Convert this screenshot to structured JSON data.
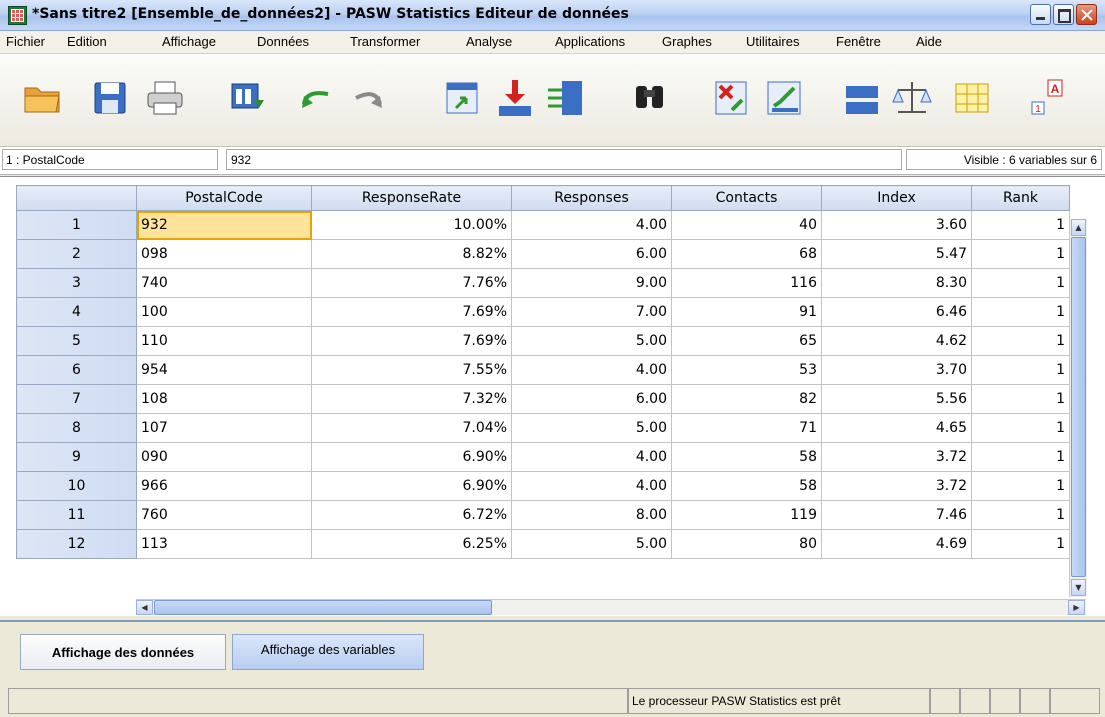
{
  "window": {
    "title": "*Sans titre2 [Ensemble_de_données2] - PASW Statistics Editeur de données"
  },
  "menu": [
    "Fichier",
    "Edition",
    "Affichage",
    "Données",
    "Transformer",
    "Analyse",
    "Applications",
    "Graphes",
    "Utilitaires",
    "Fenêtre",
    "Aide"
  ],
  "toolbar": {
    "icons": [
      "open-folder-icon",
      "save-icon",
      "print-icon",
      "dialog-recall-icon",
      "undo-icon",
      "redo-icon",
      "goto-case-icon",
      "goto-variable-icon",
      "variables-icon",
      "find-icon",
      "insert-cases-icon",
      "insert-variable-icon",
      "split-file-icon",
      "weight-cases-icon",
      "select-cases-icon",
      "value-labels-icon"
    ]
  },
  "editor": {
    "cell_ref": "1 : PostalCode",
    "cell_value": "932",
    "visible": "Visible : 6 variables sur 6"
  },
  "grid": {
    "columns": [
      "PostalCode",
      "ResponseRate",
      "Responses",
      "Contacts",
      "Index",
      "Rank"
    ],
    "rows": [
      {
        "n": "1",
        "c": [
          "932",
          "10.00%",
          "4.00",
          "40",
          "3.60",
          "1"
        ]
      },
      {
        "n": "2",
        "c": [
          "098",
          "8.82%",
          "6.00",
          "68",
          "5.47",
          "1"
        ]
      },
      {
        "n": "3",
        "c": [
          "740",
          "7.76%",
          "9.00",
          "116",
          "8.30",
          "1"
        ]
      },
      {
        "n": "4",
        "c": [
          "100",
          "7.69%",
          "7.00",
          "91",
          "6.46",
          "1"
        ]
      },
      {
        "n": "5",
        "c": [
          "110",
          "7.69%",
          "5.00",
          "65",
          "4.62",
          "1"
        ]
      },
      {
        "n": "6",
        "c": [
          "954",
          "7.55%",
          "4.00",
          "53",
          "3.70",
          "1"
        ]
      },
      {
        "n": "7",
        "c": [
          "108",
          "7.32%",
          "6.00",
          "82",
          "5.56",
          "1"
        ]
      },
      {
        "n": "8",
        "c": [
          "107",
          "7.04%",
          "5.00",
          "71",
          "4.65",
          "1"
        ]
      },
      {
        "n": "9",
        "c": [
          "090",
          "6.90%",
          "4.00",
          "58",
          "3.72",
          "1"
        ]
      },
      {
        "n": "10",
        "c": [
          "966",
          "6.90%",
          "4.00",
          "58",
          "3.72",
          "1"
        ]
      },
      {
        "n": "11",
        "c": [
          "760",
          "6.72%",
          "8.00",
          "119",
          "7.46",
          "1"
        ]
      },
      {
        "n": "12",
        "c": [
          "113",
          "6.25%",
          "5.00",
          "80",
          "4.69",
          "1"
        ]
      }
    ]
  },
  "tabs": {
    "data_view": "Affichage des données",
    "variable_view": "Affichage des variables"
  },
  "status": {
    "message": "Le processeur PASW Statistics  est prêt"
  }
}
